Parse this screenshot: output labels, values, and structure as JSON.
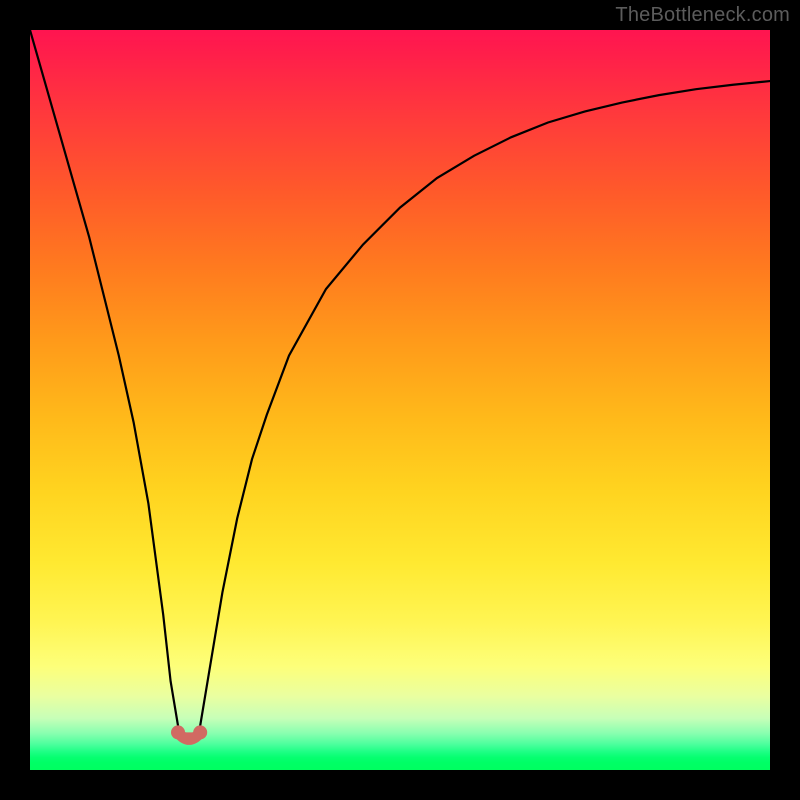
{
  "watermark": "TheBottleneck.com",
  "colors": {
    "curve": "#000000",
    "marker": "#d16a62",
    "frame": "#000000"
  },
  "chart_data": {
    "type": "line",
    "title": "",
    "xlabel": "",
    "ylabel": "",
    "xlim": [
      0,
      100
    ],
    "ylim": [
      0,
      100
    ],
    "x": [
      0,
      2,
      4,
      6,
      8,
      10,
      12,
      14,
      16,
      18,
      19,
      20,
      21,
      22,
      23,
      24,
      26,
      28,
      30,
      32,
      35,
      40,
      45,
      50,
      55,
      60,
      65,
      70,
      75,
      80,
      85,
      90,
      95,
      100
    ],
    "values": [
      100,
      93,
      86,
      79,
      72,
      64,
      56,
      47,
      36,
      21,
      12,
      6,
      4,
      4,
      6,
      12,
      24,
      34,
      42,
      48,
      56,
      65,
      71,
      76,
      80,
      83,
      85.5,
      87.5,
      89,
      90.2,
      91.2,
      92,
      92.6,
      93.1
    ],
    "minimum": {
      "x_range": [
        20,
        23
      ],
      "y": 4
    },
    "annotations": []
  }
}
